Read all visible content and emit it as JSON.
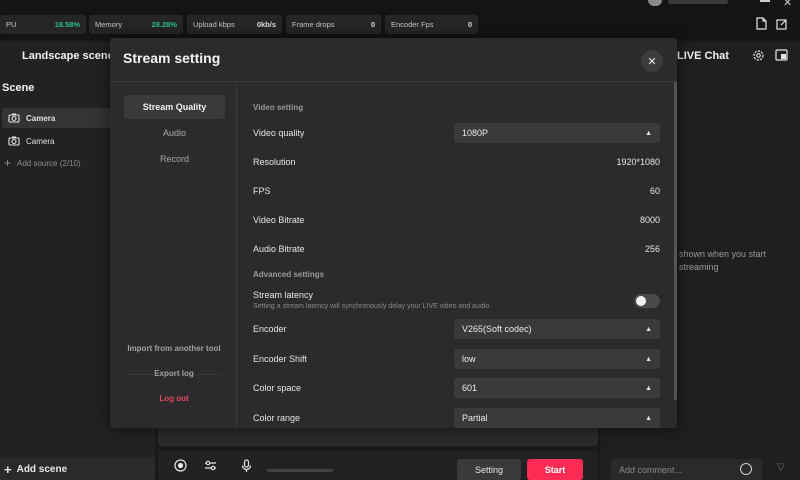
{
  "stats": [
    {
      "label": "PU",
      "value": "18.58%",
      "green": true
    },
    {
      "label": "Memory",
      "value": "28.28%",
      "green": true
    },
    {
      "label": "Upload kbps",
      "value": "0kb/s",
      "green": false
    },
    {
      "label": "Frame drops",
      "value": "0",
      "green": false
    },
    {
      "label": "Encoder Fps",
      "value": "0",
      "green": false
    }
  ],
  "left": {
    "header": "Landscape scenes",
    "scene_title": "Scene",
    "sources": [
      "Camera",
      "Camera"
    ],
    "add_source": "Add source (2/10)",
    "add_scene": "Add scene"
  },
  "controls": {
    "setting": "Setting",
    "start": "Start"
  },
  "chat": {
    "title": "LIVE Chat",
    "hint": "shown when you start streaming",
    "comment_placeholder": "Add comment..."
  },
  "modal": {
    "title": "Stream setting",
    "tabs": [
      "Stream Quality",
      "Audio",
      "Record"
    ],
    "links": {
      "import": "Import from another tool",
      "export": "Export log",
      "logout": "Log out"
    },
    "video_setting_title": "Video setting",
    "video_quality_label": "Video quality",
    "video_quality_value": "1080P",
    "resolution_label": "Resolution",
    "resolution_value": "1920*1080",
    "fps_label": "FPS",
    "fps_value": "60",
    "video_bitrate_label": "Video Bitrate",
    "video_bitrate_value": "8000",
    "audio_bitrate_label": "Audio Bitrate",
    "audio_bitrate_value": "256",
    "advanced_title": "Advanced settings",
    "latency_label": "Stream latency",
    "latency_desc": "Setting a stream latency will synchronously delay your LIVE video and audio",
    "latency_enabled": false,
    "encoder_label": "Encoder",
    "encoder_value": "V265(Soft codec)",
    "encoder_shift_label": "Encoder Shift",
    "encoder_shift_value": "low",
    "color_space_label": "Color space",
    "color_space_value": "601",
    "color_range_label": "Color range",
    "color_range_value": "Partial"
  },
  "colors": {
    "accent_red": "#fe2c55",
    "stat_green": "#2bbf8a",
    "logout_red": "#e8455f"
  }
}
